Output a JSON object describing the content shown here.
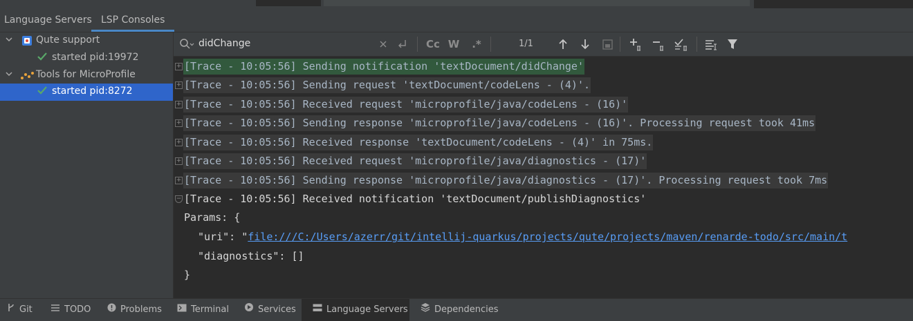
{
  "tabs": [
    {
      "label": "Language Servers"
    },
    {
      "label": "LSP Consoles"
    }
  ],
  "tree": {
    "qute": {
      "label": "Qute support",
      "status": "started pid:19972"
    },
    "micro": {
      "label": "Tools for MicroProfile",
      "status": "started pid:8272"
    }
  },
  "search": {
    "value": "didChange",
    "counter": "1/1"
  },
  "toolbar": {
    "match_case": "Cc",
    "words": "W",
    "regex": ".*"
  },
  "log": [
    "[Trace - 10:05:56] Sending notification 'textDocument/didChange'",
    "[Trace - 10:05:56] Sending request 'textDocument/codeLens - (4)'.",
    "[Trace - 10:05:56] Received request 'microprofile/java/codeLens - (16)'",
    "[Trace - 10:05:56] Sending response 'microprofile/java/codeLens - (16)'. Processing request took 41ms",
    "[Trace - 10:05:56] Received response 'textDocument/codeLens - (4)' in 75ms.",
    "[Trace - 10:05:56] Received request 'microprofile/java/diagnostics - (17)'",
    "[Trace - 10:05:56] Sending response 'microprofile/java/diagnostics - (17)'. Processing request took 7ms",
    "[Trace - 10:05:56] Received notification 'textDocument/publishDiagnostics'"
  ],
  "params": {
    "open": "Params: {",
    "uri_key": "\"uri\": \"",
    "uri_value": "file:///C:/Users/azerr/git/intellij-quarkus/projects/qute/projects/maven/renarde-todo/src/main/t",
    "diagnostics": "\"diagnostics\": []",
    "close": "}"
  },
  "statusbar": [
    {
      "label": "Git"
    },
    {
      "label": "TODO"
    },
    {
      "label": "Problems"
    },
    {
      "label": "Terminal"
    },
    {
      "label": "Services"
    },
    {
      "label": "Language Servers"
    },
    {
      "label": "Dependencies"
    }
  ]
}
